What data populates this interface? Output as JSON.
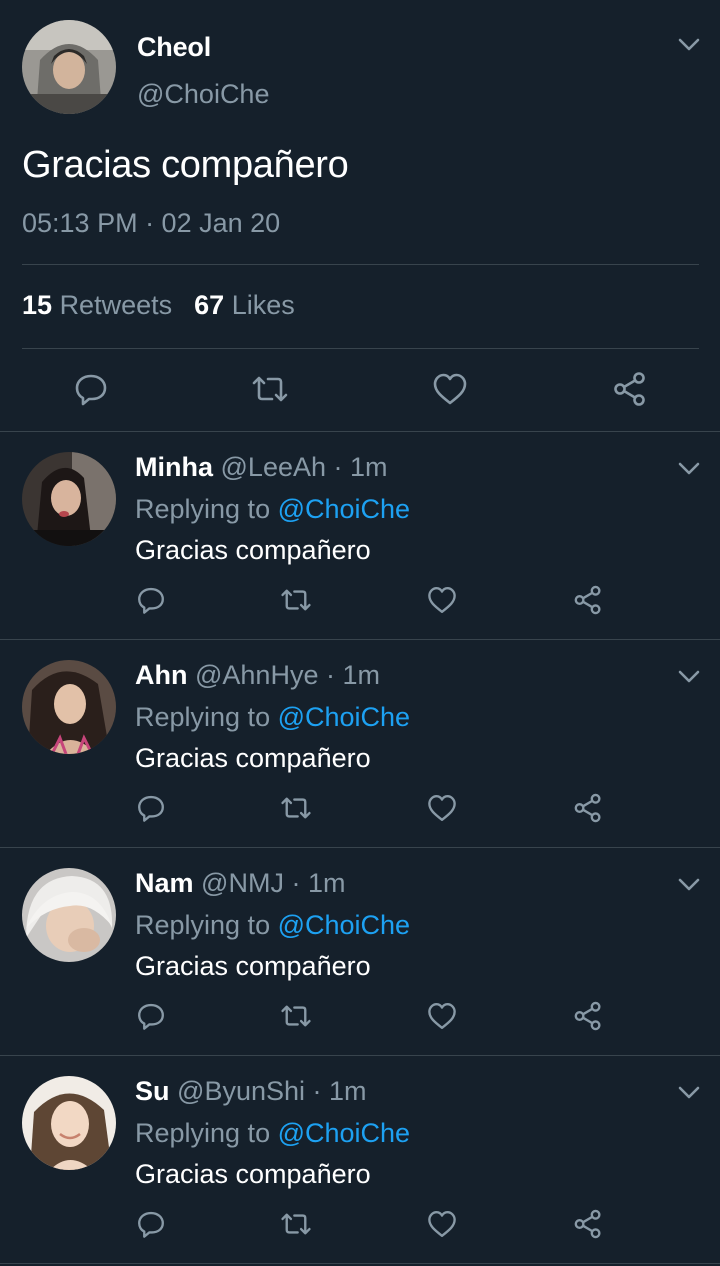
{
  "main_tweet": {
    "name": "Cheol",
    "handle": "@ChoiChe",
    "text": "Gracias compañero",
    "timestamp": "05:13 PM · 02 Jan 20",
    "retweets_count": "15",
    "retweets_label": "Retweets",
    "likes_count": "67",
    "likes_label": "Likes",
    "actions": [
      "reply-icon",
      "retweet-icon",
      "like-icon",
      "share-icon"
    ]
  },
  "replies": [
    {
      "name": "Minha",
      "handle": "@LeeAh",
      "time": "· 1m",
      "replying_label": "Replying to",
      "mention": "@ChoiChe",
      "text": "Gracias compañero"
    },
    {
      "name": "Ahn",
      "handle": "@AhnHye",
      "time": "· 1m",
      "replying_label": "Replying to",
      "mention": "@ChoiChe",
      "text": "Gracias compañero"
    },
    {
      "name": "Nam",
      "handle": "@NMJ",
      "time": "· 1m",
      "replying_label": "Replying to",
      "mention": "@ChoiChe",
      "text": "Gracias compañero"
    },
    {
      "name": "Su",
      "handle": "@ByunShi",
      "time": "· 1m",
      "replying_label": "Replying to",
      "mention": "@ChoiChe",
      "text": "Gracias compañero"
    }
  ],
  "colors": {
    "background": "#15202b",
    "secondary_text": "#8899a6",
    "accent": "#1da1f2",
    "divider": "#38444d"
  }
}
